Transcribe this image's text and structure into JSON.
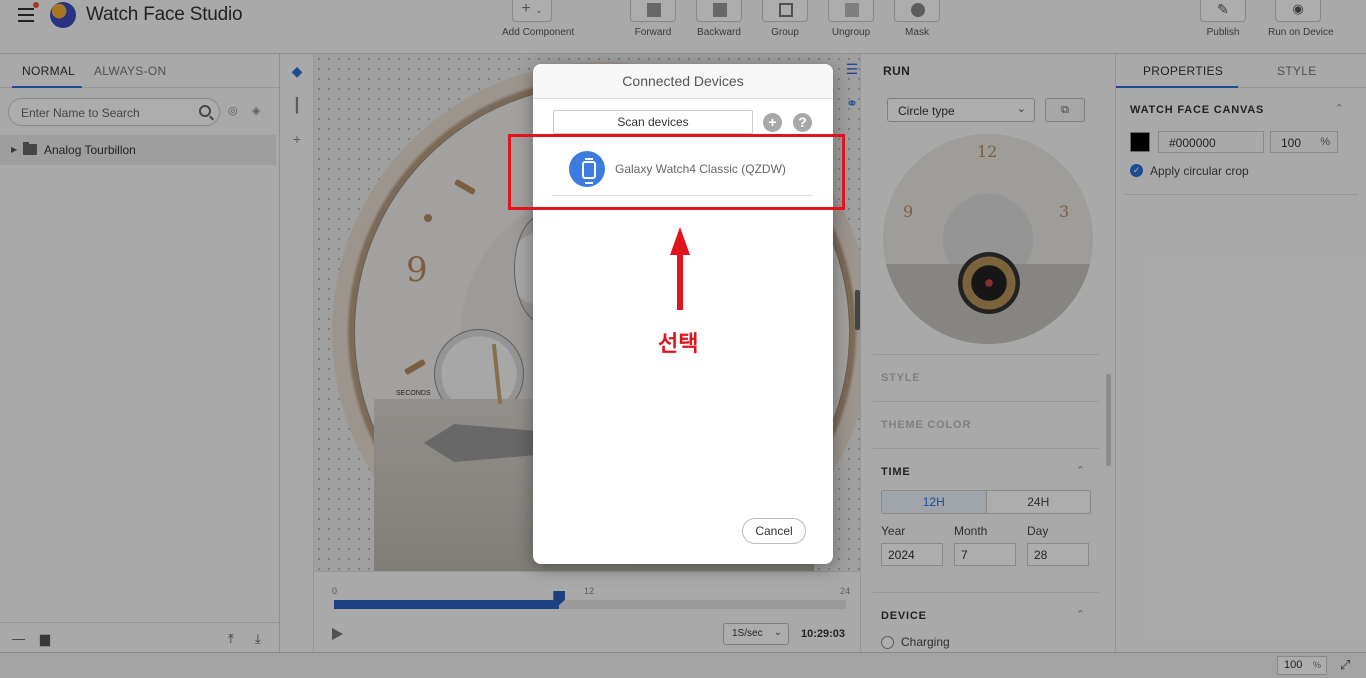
{
  "app": {
    "title": "Watch Face Studio"
  },
  "toolbar": {
    "add_component": "Add Component",
    "forward": "Forward",
    "backward": "Backward",
    "group": "Group",
    "ungroup": "Ungroup",
    "mask": "Mask",
    "publish": "Publish",
    "run_on_device": "Run on Device"
  },
  "left_panel": {
    "tabs": [
      "NORMAL",
      "ALWAYS-ON"
    ],
    "active_tab": "NORMAL",
    "search_placeholder": "Enter Name to Search",
    "layers": [
      {
        "name": "Analog Tourbillon",
        "type": "folder"
      }
    ]
  },
  "canvas": {
    "numerals": [
      "9"
    ],
    "seconds_label": "SECONDS"
  },
  "timeline": {
    "start": "0",
    "mid": "12",
    "end": "24",
    "position_fraction": 0.44,
    "speed": "1S/sec",
    "time": "10:29:03"
  },
  "run_panel": {
    "title": "RUN",
    "shape_select": "Circle type",
    "preview_numerals": [
      "12",
      "9",
      "3"
    ],
    "sections": {
      "style": "STYLE",
      "theme_color": "THEME COLOR",
      "time": "TIME",
      "device": "DEVICE"
    },
    "time_format": {
      "options": [
        "12H",
        "24H"
      ],
      "selected": "12H"
    },
    "date": {
      "year_label": "Year",
      "year": "2024",
      "month_label": "Month",
      "month": "7",
      "day_label": "Day",
      "day": "28"
    },
    "device_state": {
      "label": "Charging",
      "checked": false
    }
  },
  "properties": {
    "tabs": [
      "PROPERTIES",
      "STYLE"
    ],
    "active_tab": "PROPERTIES",
    "section_title": "WATCH FACE CANVAS",
    "color_hex": "#000000",
    "opacity": "100",
    "opacity_unit": "%",
    "apply_circular_crop": "Apply circular crop"
  },
  "status_bar": {
    "zoom": "100",
    "zoom_unit": "%"
  },
  "dialog": {
    "title": "Connected Devices",
    "scan_button": "Scan devices",
    "add_symbol": "+",
    "help_symbol": "?",
    "devices": [
      {
        "name": "Galaxy Watch4 Classic (QZDW)"
      }
    ],
    "cancel_button": "Cancel"
  },
  "annotation": {
    "text": "선택",
    "color": "#e0141e"
  },
  "colors": {
    "accent": "#2b6fd6",
    "timeline": "#2a5fc0",
    "device_icon": "#3d7be0"
  }
}
